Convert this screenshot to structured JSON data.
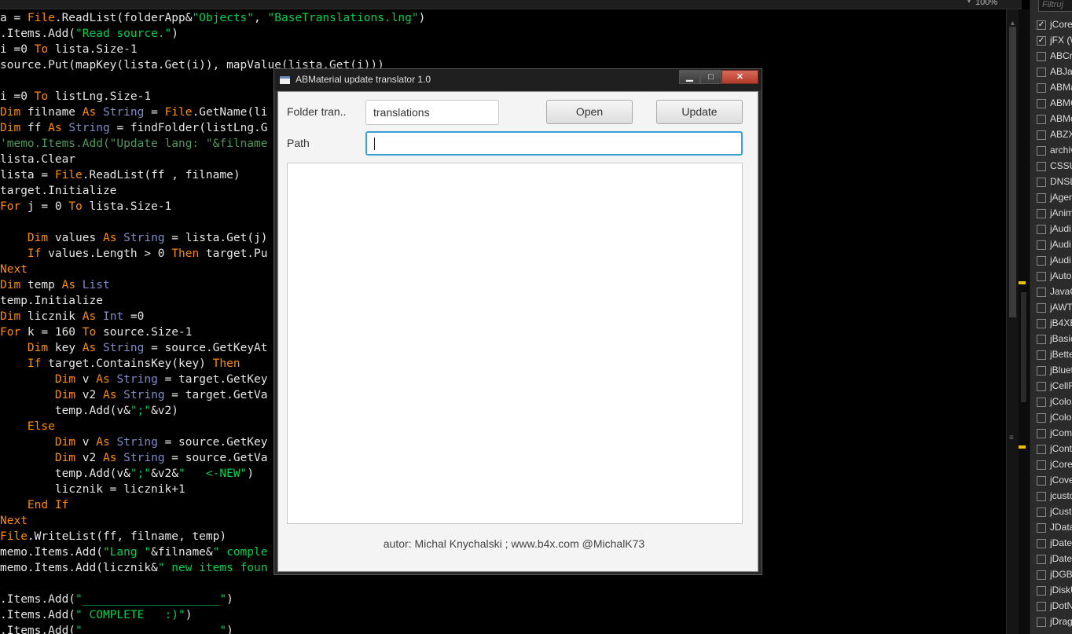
{
  "editor": {
    "zoom": "100%",
    "lines": [
      [
        [
          "a = ",
          ""
        ],
        [
          "File",
          "kw"
        ],
        [
          ".ReadList(folderApp&",
          ""
        ],
        [
          "\"Objects\"",
          "st"
        ],
        [
          ", ",
          ""
        ],
        [
          "\"BaseTranslations.lng\"",
          "st"
        ],
        [
          ")",
          ""
        ]
      ],
      [
        [
          ".Items.Add(",
          ""
        ],
        [
          "\"Read source.\"",
          "st"
        ],
        [
          ")",
          ""
        ]
      ],
      [
        [
          "i =0 ",
          ""
        ],
        [
          "To",
          "kw"
        ],
        [
          " lista.Size-1",
          ""
        ]
      ],
      [
        [
          "source.Put(mapKey(lista.Get(i)), mapValue(lista.Get(i)))",
          ""
        ]
      ],
      [],
      [
        [
          "i =0 ",
          ""
        ],
        [
          "To",
          "kw"
        ],
        [
          " listLng.Size-1",
          ""
        ]
      ],
      [
        [
          "Dim",
          "kw"
        ],
        [
          " filname ",
          ""
        ],
        [
          "As",
          "kw"
        ],
        [
          " ",
          ""
        ],
        [
          "String",
          "ty"
        ],
        [
          " = ",
          ""
        ],
        [
          "File",
          "kw"
        ],
        [
          ".GetName(li",
          ""
        ]
      ],
      [
        [
          "Dim",
          "kw"
        ],
        [
          " ff ",
          ""
        ],
        [
          "As",
          "kw"
        ],
        [
          " ",
          ""
        ],
        [
          "String",
          "ty"
        ],
        [
          " = findFolder(listLng.G",
          ""
        ]
      ],
      [
        [
          "'memo.Items.Add(\"Update lang: \"&filname",
          "cm"
        ]
      ],
      [
        [
          "lista.Clear",
          ""
        ]
      ],
      [
        [
          "lista = ",
          ""
        ],
        [
          "File",
          "kw"
        ],
        [
          ".ReadList(ff , filname)",
          ""
        ]
      ],
      [
        [
          "target.Initialize",
          ""
        ]
      ],
      [
        [
          "For",
          "kw"
        ],
        [
          " j = 0 ",
          ""
        ],
        [
          "To",
          "kw"
        ],
        [
          " lista.Size-1",
          ""
        ]
      ],
      [],
      [
        [
          "    ",
          ""
        ],
        [
          "Dim",
          "kw"
        ],
        [
          " values ",
          ""
        ],
        [
          "As",
          "kw"
        ],
        [
          " ",
          ""
        ],
        [
          "String",
          "ty"
        ],
        [
          " = lista.Get(j)",
          ""
        ]
      ],
      [
        [
          "    ",
          ""
        ],
        [
          "If",
          "kw"
        ],
        [
          " values.Length > 0 ",
          ""
        ],
        [
          "Then",
          "kw"
        ],
        [
          " target.Pu",
          ""
        ]
      ],
      [
        [
          "Next",
          "kw"
        ]
      ],
      [
        [
          "Dim",
          "kw"
        ],
        [
          " temp ",
          ""
        ],
        [
          "As",
          "kw"
        ],
        [
          " ",
          ""
        ],
        [
          "List",
          "ty"
        ]
      ],
      [
        [
          "temp.Initialize",
          ""
        ]
      ],
      [
        [
          "Dim",
          "kw"
        ],
        [
          " licznik ",
          ""
        ],
        [
          "As",
          "kw"
        ],
        [
          " ",
          ""
        ],
        [
          "Int",
          "ty"
        ],
        [
          " =0",
          ""
        ]
      ],
      [
        [
          "For",
          "kw"
        ],
        [
          " k = 160 ",
          ""
        ],
        [
          "To",
          "kw"
        ],
        [
          " source.Size-1",
          ""
        ]
      ],
      [
        [
          "    ",
          ""
        ],
        [
          "Dim",
          "kw"
        ],
        [
          " key ",
          ""
        ],
        [
          "As",
          "kw"
        ],
        [
          " ",
          ""
        ],
        [
          "String",
          "ty"
        ],
        [
          " = source.GetKeyAt",
          ""
        ]
      ],
      [
        [
          "    ",
          ""
        ],
        [
          "If",
          "kw"
        ],
        [
          " target.ContainsKey(key) ",
          ""
        ],
        [
          "Then",
          "kw"
        ]
      ],
      [
        [
          "        ",
          ""
        ],
        [
          "Dim",
          "kw"
        ],
        [
          " v ",
          ""
        ],
        [
          "As",
          "kw"
        ],
        [
          " ",
          ""
        ],
        [
          "String",
          "ty"
        ],
        [
          " = target.GetKey",
          ""
        ]
      ],
      [
        [
          "        ",
          ""
        ],
        [
          "Dim",
          "kw"
        ],
        [
          " v2 ",
          ""
        ],
        [
          "As",
          "kw"
        ],
        [
          " ",
          ""
        ],
        [
          "String",
          "ty"
        ],
        [
          " = target.GetVa",
          ""
        ]
      ],
      [
        [
          "        temp.Add(v&",
          ""
        ],
        [
          "\";\"",
          "st"
        ],
        [
          "&v2)",
          ""
        ]
      ],
      [
        [
          "    ",
          ""
        ],
        [
          "Else",
          "kw"
        ]
      ],
      [
        [
          "        ",
          ""
        ],
        [
          "Dim",
          "kw"
        ],
        [
          " v ",
          ""
        ],
        [
          "As",
          "kw"
        ],
        [
          " ",
          ""
        ],
        [
          "String",
          "ty"
        ],
        [
          " = source.GetKey",
          ""
        ]
      ],
      [
        [
          "        ",
          ""
        ],
        [
          "Dim",
          "kw"
        ],
        [
          " v2 ",
          ""
        ],
        [
          "As",
          "kw"
        ],
        [
          " ",
          ""
        ],
        [
          "String",
          "ty"
        ],
        [
          " = source.GetVa",
          ""
        ]
      ],
      [
        [
          "        temp.Add(v&",
          ""
        ],
        [
          "\";\"",
          "st"
        ],
        [
          "&v2&",
          ""
        ],
        [
          "\"   <-NEW\"",
          "st"
        ],
        [
          ")",
          ""
        ]
      ],
      [
        [
          "        licznik = licznik+1",
          ""
        ]
      ],
      [
        [
          "    ",
          ""
        ],
        [
          "End If",
          "kw"
        ]
      ],
      [
        [
          "Next",
          "kw"
        ]
      ],
      [
        [
          "File",
          "kw"
        ],
        [
          ".WriteList(ff, filname, temp)",
          ""
        ]
      ],
      [
        [
          "memo.Items.Add(",
          ""
        ],
        [
          "\"Lang \"",
          "st"
        ],
        [
          "&filname&",
          ""
        ],
        [
          "\" comple",
          "st"
        ]
      ],
      [
        [
          "memo.Items.Add(licznik&",
          ""
        ],
        [
          "\" new items foun",
          "st"
        ]
      ],
      [],
      [
        [
          ".Items.Add(",
          ""
        ],
        [
          "\"____________________\"",
          "st"
        ],
        [
          ")",
          ""
        ]
      ],
      [
        [
          ".Items.Add(",
          ""
        ],
        [
          "\" COMPLETE   :)\"",
          "st"
        ],
        [
          ")",
          ""
        ]
      ],
      [
        [
          ".Items.Add(",
          ""
        ],
        [
          "\"____________________\"",
          "st"
        ],
        [
          ")",
          ""
        ]
      ]
    ]
  },
  "libraries": {
    "filter_placeholder": "Filtruj",
    "items": [
      {
        "label": "jCore",
        "checked": true
      },
      {
        "label": "jFX (W",
        "checked": true
      },
      {
        "label": "ABCr",
        "checked": false
      },
      {
        "label": "ABJas",
        "checked": false
      },
      {
        "label": "ABMa",
        "checked": false
      },
      {
        "label": "ABMC",
        "checked": false
      },
      {
        "label": "ABMo",
        "checked": false
      },
      {
        "label": "ABZX",
        "checked": false
      },
      {
        "label": "archiv",
        "checked": false
      },
      {
        "label": "CSSU",
        "checked": false
      },
      {
        "label": "DNSL",
        "checked": false
      },
      {
        "label": "jAgen",
        "checked": false
      },
      {
        "label": "jAnim",
        "checked": false
      },
      {
        "label": "jAudi",
        "checked": false
      },
      {
        "label": "jAudi",
        "checked": false
      },
      {
        "label": "jAudi",
        "checked": false
      },
      {
        "label": "jAuto",
        "checked": false
      },
      {
        "label": "JavaC",
        "checked": false
      },
      {
        "label": "jAWT",
        "checked": false
      },
      {
        "label": "jB4XE",
        "checked": false
      },
      {
        "label": "jBasic",
        "checked": false
      },
      {
        "label": "jBette",
        "checked": false
      },
      {
        "label": "jBluet",
        "checked": false
      },
      {
        "label": "jCellF",
        "checked": false
      },
      {
        "label": "jColo",
        "checked": false
      },
      {
        "label": "jColo",
        "checked": false
      },
      {
        "label": "jCom",
        "checked": false
      },
      {
        "label": "jCont",
        "checked": false
      },
      {
        "label": "jCore",
        "checked": false
      },
      {
        "label": "jCove",
        "checked": false
      },
      {
        "label": "jcusto",
        "checked": false
      },
      {
        "label": "jCusto",
        "checked": false
      },
      {
        "label": "JData",
        "checked": false
      },
      {
        "label": "jDate",
        "checked": false
      },
      {
        "label": "jDate",
        "checked": false
      },
      {
        "label": "jDGBa",
        "checked": false
      },
      {
        "label": "jDiskU",
        "checked": false
      },
      {
        "label": "jDotN",
        "checked": false
      },
      {
        "label": "jDrag",
        "checked": false
      }
    ]
  },
  "dialog": {
    "title": "ABMaterial update translator 1.0",
    "folder_label": "Folder tran..",
    "folder_value": "translations",
    "path_label": "Path",
    "path_value": "",
    "open_label": "Open",
    "update_label": "Update",
    "minimize_glyph": "▁",
    "maximize_glyph": "□",
    "close_glyph": "✕",
    "footer": "autor: Michal Knychalski ; www.b4x.com @MichalK73"
  }
}
